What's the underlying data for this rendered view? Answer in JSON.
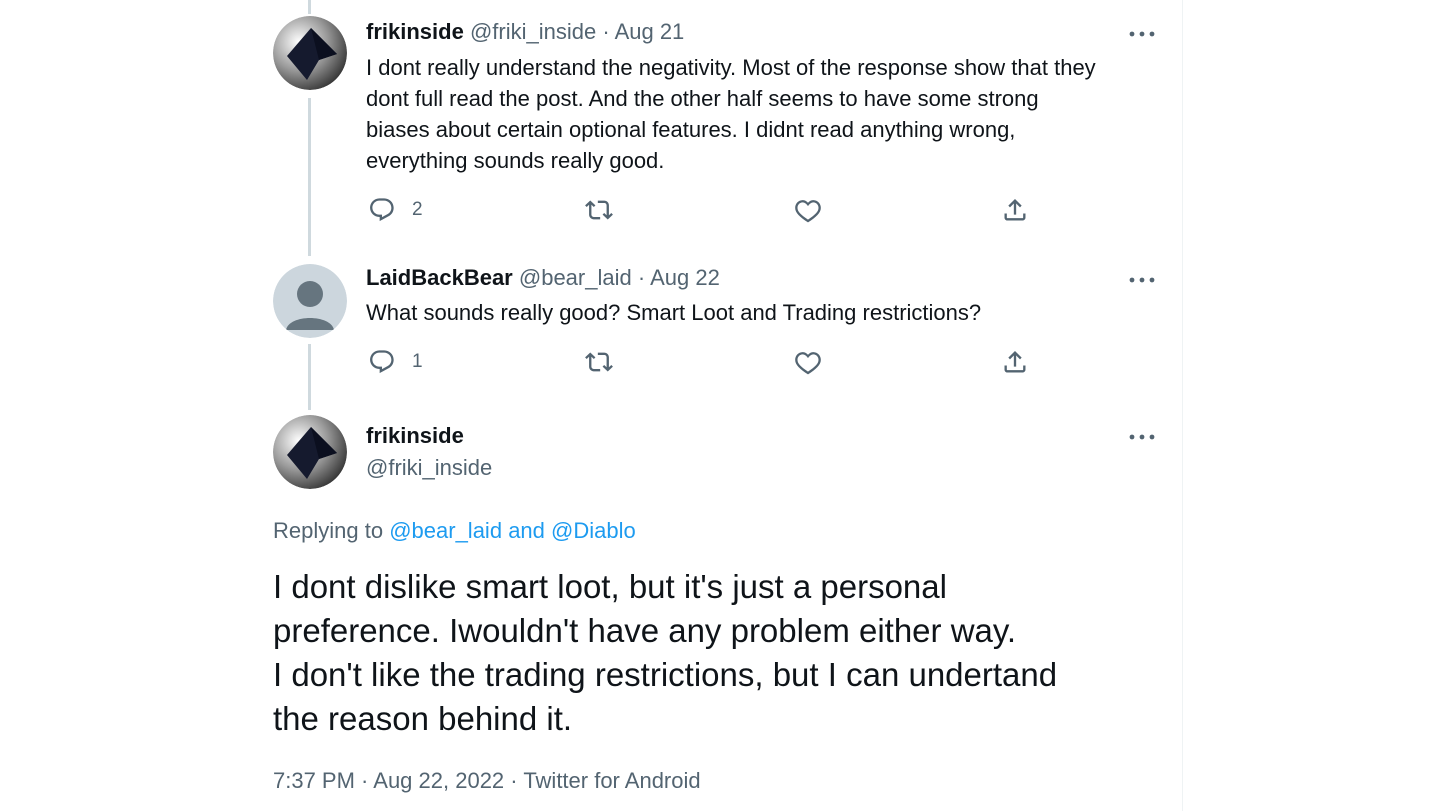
{
  "tweets": [
    {
      "name": "frikinside",
      "handle": "@friki_inside",
      "sep": "·",
      "date": "Aug 21",
      "lines": [
        "I dont really understand the negativity. Most of the response show that they",
        "dont full read the post. And the other half seems to have some strong",
        "biases about certain optional features. I didnt read anything wrong,",
        "everything sounds really good."
      ],
      "reply_count": "2",
      "avatar_icon": "black-flag-avatar"
    },
    {
      "name": "LaidBackBear",
      "handle": "@bear_laid",
      "sep": "·",
      "date": "Aug 22",
      "lines": [
        "What sounds really good? Smart Loot and Trading restrictions?"
      ],
      "reply_count": "1",
      "avatar_icon": "default-person-avatar"
    }
  ],
  "main": {
    "name": "frikinside",
    "handle": "@friki_inside",
    "replying_prefix": "Replying to",
    "replying_to_1": "@bear_laid",
    "replying_and": "and",
    "replying_to_2": "@Diablo",
    "lines": [
      "I dont dislike smart loot, but it's just a personal",
      "preference. Iwouldn't have any problem either way.",
      "I don't like the trading restrictions, but I can undertand",
      "the reason behind it."
    ],
    "meta": "7:37 PM · Aug 22, 2022 · Twitter for Android"
  },
  "colors": {
    "text": "#0f1419",
    "muted": "#536471",
    "link": "#1d9bf0",
    "thread_line": "#cfd9de"
  },
  "icons": [
    "reply-icon",
    "retweet-icon",
    "like-icon",
    "share-icon",
    "more-icon"
  ]
}
